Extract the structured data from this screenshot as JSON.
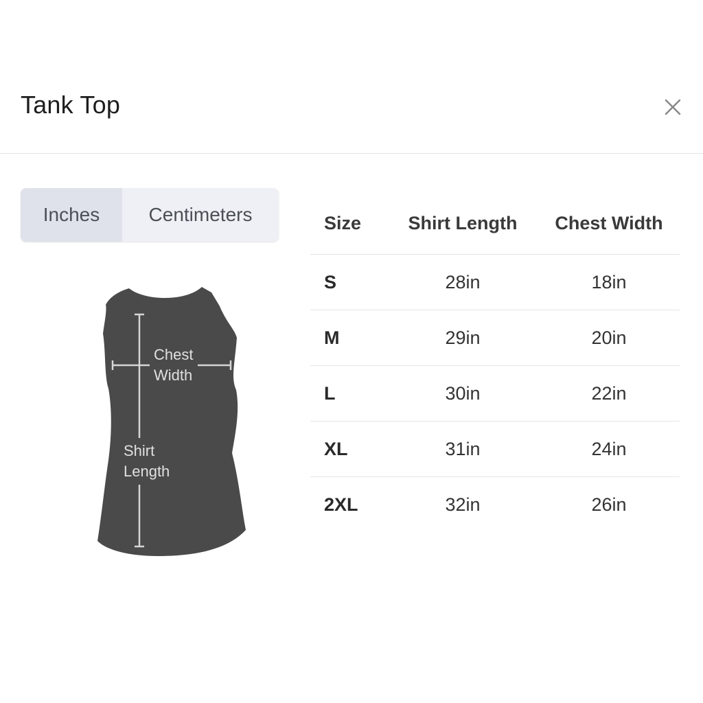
{
  "dialog": {
    "title": "Tank Top"
  },
  "units": {
    "inches_label": "Inches",
    "centimeters_label": "Centimeters",
    "selected": "Inches"
  },
  "diagram": {
    "chest_label_line1": "Chest",
    "chest_label_line2": "Width",
    "length_label_line1": "Shirt",
    "length_label_line2": "Length",
    "garment_color": "#4a4a4a"
  },
  "table": {
    "headers": [
      "Size",
      "Shirt Length",
      "Chest Width"
    ],
    "rows": [
      {
        "size": "S",
        "length": "28in",
        "chest": "18in"
      },
      {
        "size": "M",
        "length": "29in",
        "chest": "20in"
      },
      {
        "size": "L",
        "length": "30in",
        "chest": "22in"
      },
      {
        "size": "XL",
        "length": "31in",
        "chest": "24in"
      },
      {
        "size": "2XL",
        "length": "32in",
        "chest": "26in"
      }
    ]
  }
}
